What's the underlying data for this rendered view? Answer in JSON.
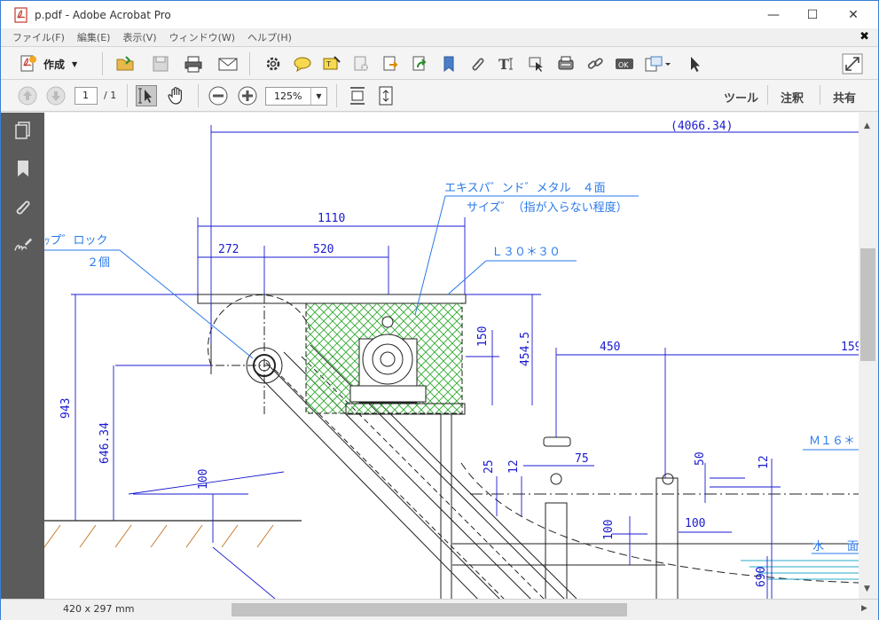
{
  "window": {
    "title": "p.pdf - Adobe Acrobat Pro",
    "minimize": "—",
    "maximize": "☐",
    "close": "✕"
  },
  "menu": {
    "items": [
      "ファイル(F)",
      "編集(E)",
      "表示(V)",
      "ウィンドウ(W)",
      "ヘルプ(H)"
    ],
    "close_doc": "✖"
  },
  "toolbar": {
    "create_label": "作成"
  },
  "nav": {
    "page_current": "1",
    "page_total": "/ 1",
    "zoom": "125%"
  },
  "panes": {
    "tools": "ツール",
    "comment": "注釈",
    "share": "共有"
  },
  "status": {
    "page_size": "420 x 297 mm"
  },
  "drawing": {
    "dim_total": "(4066.34)",
    "mesh_note_line1": "エキスパ゛ンド゛メタル　４面",
    "mesh_note_line2": "サイズ゛（指が入らない程度）",
    "block_note_line1": "ｯプ゛ロック",
    "block_note_line2": "２個",
    "angle_note": "Ｌ３０＊３０",
    "bolt_note": "Ｍ１６＊",
    "water_note": "水　　面",
    "dim_1110": "1110",
    "dim_272": "272",
    "dim_520": "520",
    "dim_150": "150",
    "dim_4545": "454.5",
    "dim_450": "450",
    "dim_159": "159",
    "dim_943": "943",
    "dim_64634": "646.34",
    "dim_100a": "100",
    "dim_25": "25",
    "dim_12a": "12",
    "dim_75": "75",
    "dim_50": "50",
    "dim_12b": "12",
    "dim_100b": "100",
    "dim_100c": "100",
    "dim_690": "690"
  }
}
